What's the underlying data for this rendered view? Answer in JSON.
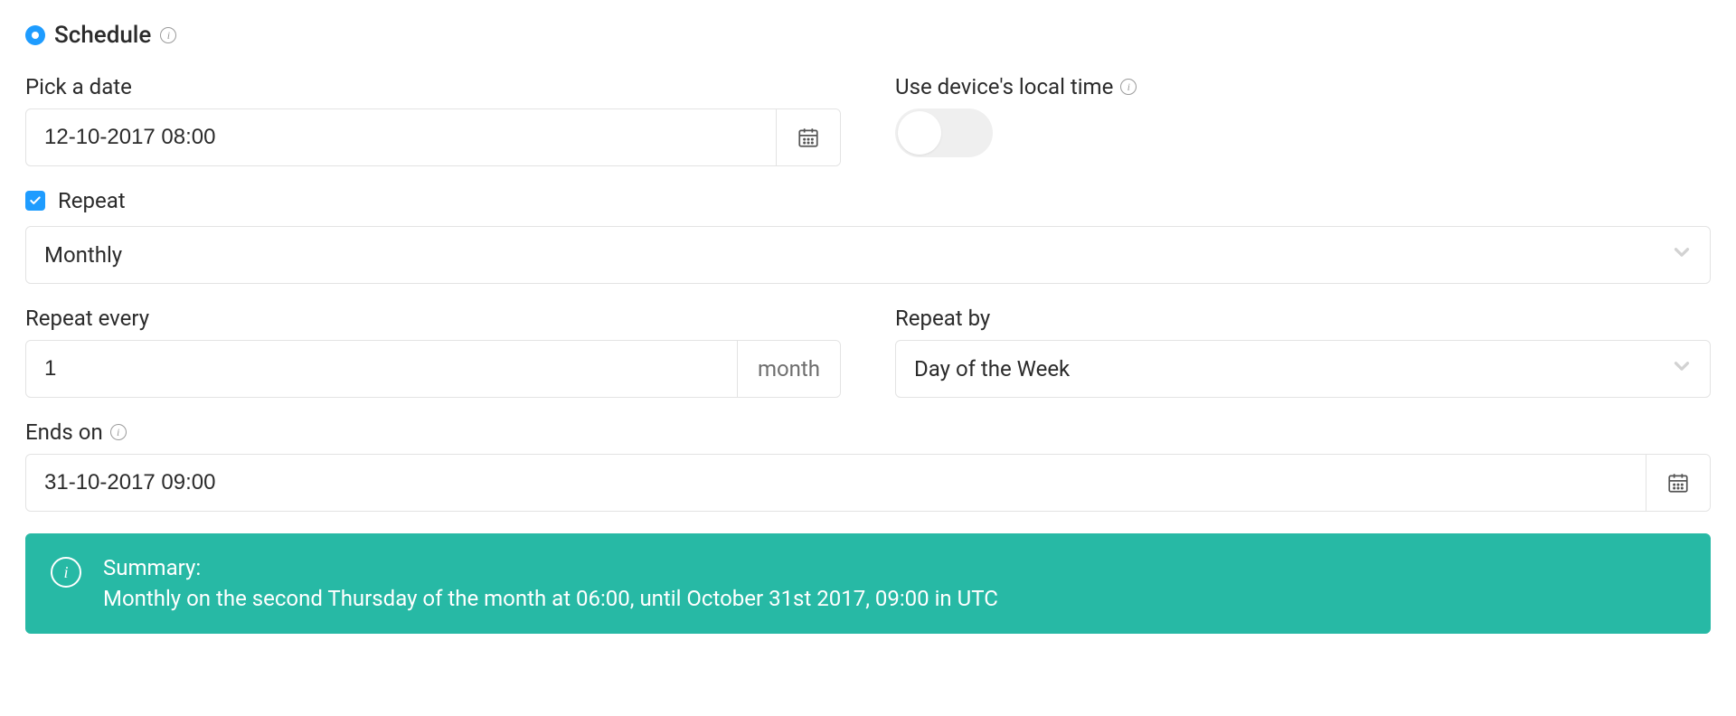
{
  "header": {
    "title": "Schedule"
  },
  "pickDate": {
    "label": "Pick a date",
    "value": "12-10-2017 08:00"
  },
  "localTime": {
    "label": "Use device's local time"
  },
  "repeat": {
    "label": "Repeat",
    "interval": "Monthly"
  },
  "repeatEvery": {
    "label": "Repeat every",
    "value": "1",
    "unit": "month"
  },
  "repeatBy": {
    "label": "Repeat by",
    "value": "Day of the Week"
  },
  "endsOn": {
    "label": "Ends on",
    "value": "31-10-2017 09:00"
  },
  "summary": {
    "title": "Summary:",
    "text": "Monthly on the second Thursday of the month at 06:00, until October 31st 2017, 09:00 in UTC"
  }
}
